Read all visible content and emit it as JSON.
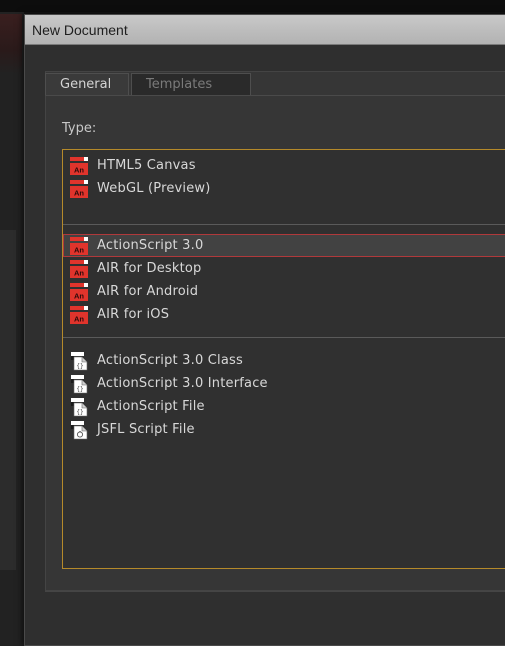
{
  "dialog": {
    "title": "New Document"
  },
  "tabs": [
    {
      "label": "General",
      "active": true
    },
    {
      "label": "Templates",
      "active": false
    }
  ],
  "type_label": "Type:",
  "groups": [
    {
      "items": [
        {
          "label": "HTML5 Canvas",
          "icon": "animate-an-icon"
        },
        {
          "label": "WebGL (Preview)",
          "icon": "animate-an-icon"
        }
      ]
    },
    {
      "items": [
        {
          "label": "ActionScript 3.0",
          "icon": "animate-an-icon",
          "selected": true
        },
        {
          "label": "AIR for Desktop",
          "icon": "animate-an-icon"
        },
        {
          "label": "AIR for Android",
          "icon": "animate-an-icon"
        },
        {
          "label": "AIR for iOS",
          "icon": "animate-an-icon"
        }
      ]
    },
    {
      "items": [
        {
          "label": "ActionScript 3.0 Class",
          "icon": "script-file-icon"
        },
        {
          "label": "ActionScript 3.0 Interface",
          "icon": "script-file-icon"
        },
        {
          "label": "ActionScript File",
          "icon": "script-file-icon"
        },
        {
          "label": "JSFL Script File",
          "icon": "jsfl-file-icon"
        }
      ]
    }
  ],
  "colors": {
    "selection_border": "#b0393b",
    "list_border": "#b58a2a",
    "an_icon_red": "#e0342c"
  }
}
